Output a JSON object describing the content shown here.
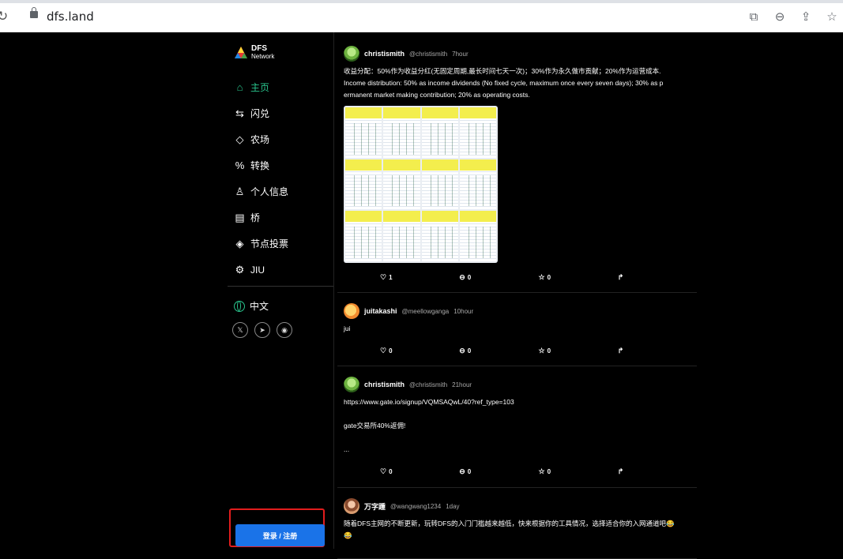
{
  "browser": {
    "url": "dfs.land"
  },
  "brand": {
    "name": "DFS",
    "sub": "Network"
  },
  "nav": [
    {
      "label": "主页",
      "icon": "home-icon",
      "glyph": "⌂",
      "active": true
    },
    {
      "label": "闪兑",
      "icon": "swap-arrows-icon",
      "glyph": "⇆",
      "active": false
    },
    {
      "label": "农场",
      "icon": "diamond-icon",
      "glyph": "◇",
      "active": false
    },
    {
      "label": "转换",
      "icon": "percent-circle-icon",
      "glyph": "%",
      "active": false
    },
    {
      "label": "个人信息",
      "icon": "user-icon",
      "glyph": "♙",
      "active": false
    },
    {
      "label": "桥",
      "icon": "bridge-icon",
      "glyph": "▤",
      "active": false
    },
    {
      "label": "节点投票",
      "icon": "ticket-icon",
      "glyph": "◈",
      "active": false
    },
    {
      "label": "JIU",
      "icon": "jiu-icon",
      "glyph": "⚙",
      "active": false
    }
  ],
  "language": "中文",
  "login_label": "登录 / 注册",
  "accent": "#29c38c",
  "posts": [
    {
      "user": "christismith",
      "handle": "@christismith",
      "time": "7hour",
      "lines": [
        "收益分配：50%作为收益分红(无固定周期,最长时间七天一次)；30%作为永久做市贡献；20%作为运营成本.",
        "Income distribution: 50% as income dividends (No fixed cycle, maximum once every seven days); 30% as p",
        "ermanent market making contribution; 20% as operating costs."
      ],
      "likes": "1",
      "comments": "0",
      "stars": "0"
    },
    {
      "user": "juitakashi",
      "handle": "@meellowganga",
      "time": "10hour",
      "lines": [
        "jui"
      ],
      "likes": "0",
      "comments": "0",
      "stars": "0"
    },
    {
      "user": "christismith",
      "handle": "@christismith",
      "time": "21hour",
      "lines": [
        "https://www.gate.io/signup/VQMSAQwL/40?ref_type=103",
        "",
        "gate交易所40%返佣!",
        "",
        "..."
      ],
      "likes": "0",
      "comments": "0",
      "stars": "0"
    },
    {
      "user": "万字踵",
      "handle": "@wangwang1234",
      "time": "1day",
      "lines": [
        "随着DFS主网的不断更新，玩转DFS的入门门槛越来越低，快来根据你的工具情况，选择适合你的入网通道吧😂",
        "😂"
      ]
    }
  ]
}
